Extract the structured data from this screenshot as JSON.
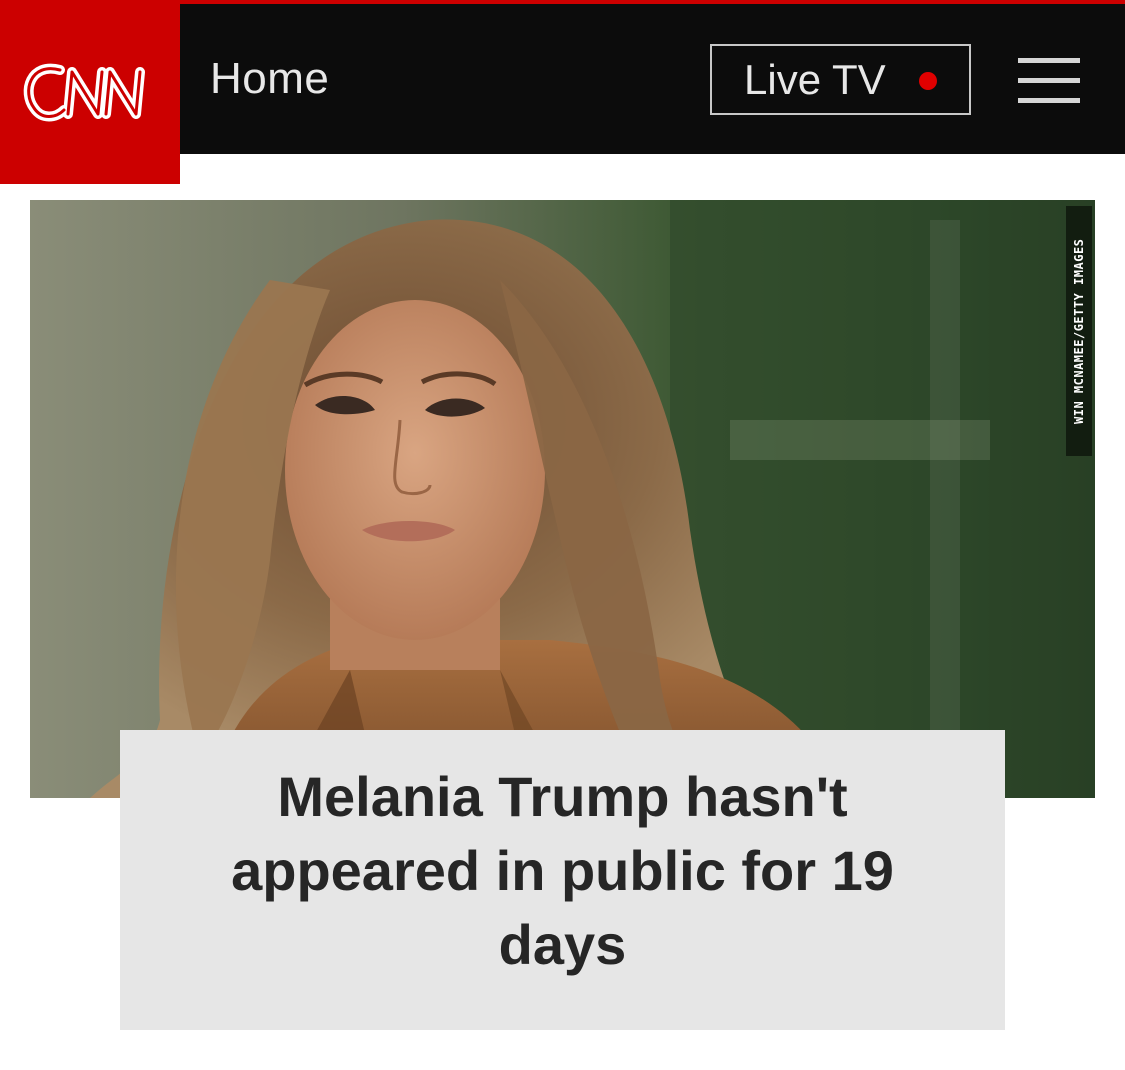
{
  "header": {
    "brand": "CNN",
    "home_label": "Home",
    "live_tv_label": "Live TV",
    "menu_icon": "hamburger-menu-icon",
    "brand_color": "#cc0000",
    "navbar_color": "#0c0c0c",
    "live_dot_color": "#e00000"
  },
  "article": {
    "image_credit": "WIN MCNAMEE/GETTY IMAGES",
    "headline": "Melania Trump hasn't appeared in public for 19 days"
  }
}
